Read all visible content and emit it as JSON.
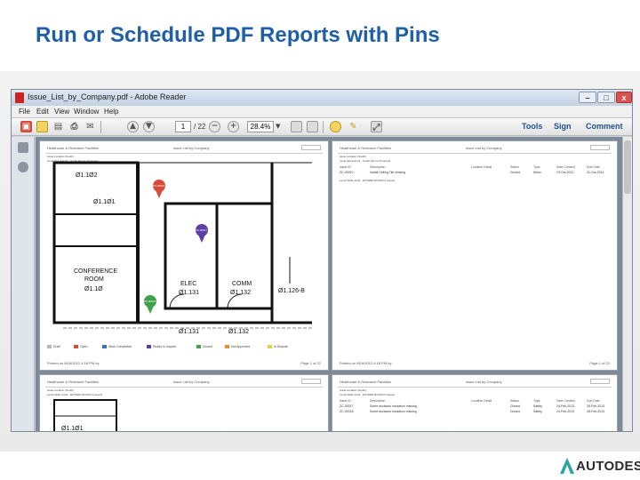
{
  "slide": {
    "title": "Run or Schedule PDF Reports with Pins",
    "brand": "AUTODESK."
  },
  "window": {
    "title": "Issue_List_by_Company.pdf - Adobe Reader",
    "min": "–",
    "max": "□",
    "close": "x"
  },
  "menu": [
    "File",
    "Edit",
    "View",
    "Window",
    "Help"
  ],
  "toolbar": {
    "page_current": "1",
    "page_total": "/ 22",
    "zoom": "28.4%",
    "tools": "Tools",
    "sign": "Sign",
    "comment": "Comment"
  },
  "report": {
    "project": "Healthcare & Research Facilities",
    "report_name": "Issue List by Company",
    "location_level": "Level 01/Level 01 - South Floors (3 Issues)",
    "location_sub": "Level 01/DL-1011 - ESTERN ROOM (3 issues)",
    "section": "Issue Location (South)",
    "footer_left": "Printed on 8/16/2012 4:18 PM by",
    "footer_right": "Page 1 of 22",
    "columns": [
      "Issue ID",
      "Description",
      "Location Detail",
      "Status",
      "Type",
      "Date Created",
      "Due Date"
    ],
    "rows_p2": [
      [
        "ZC-00010",
        "Install Ceiling Tile missing",
        "",
        "Closed",
        "Minor",
        "19-Oct-2012",
        "31-Oct-2012"
      ]
    ],
    "rows_p4": [
      [
        "ZC-00017",
        "Some ductwork insulation missing",
        "",
        "Closed",
        "Safety",
        "24-Feb-2013",
        "28-Feb-2013"
      ],
      [
        "ZC-00018",
        "Some ductwork insulation missing",
        "",
        "Closed",
        "Safety",
        "24-Feb-2013",
        "28-Feb-2013"
      ]
    ],
    "rooms": {
      "conference_label": "CONFERENCE",
      "conference_room": "ROOM",
      "conference_num": "Ø1.1Ø",
      "elec_label": "ELEC",
      "elec_num": "Ø1.131",
      "comm_label": "COMM",
      "comm_num": "Ø1.132",
      "r1": "Ø1.1Ø2",
      "r2": "Ø1.1Ø1",
      "r3": "Ø1.126-B",
      "r4": "Ø1.131",
      "r5": "Ø1.132",
      "p3_r1": "Ø1.1Ø1"
    },
    "pins": [
      {
        "id": "ZC-00010",
        "color": "#d64a3c"
      },
      {
        "id": "ZC-00017",
        "color": "#5b3fa6"
      },
      {
        "id": "ZC-00018",
        "color": "#3fa14a"
      }
    ],
    "legend": [
      {
        "label": "Draft",
        "color": "#b8b8b8"
      },
      {
        "label": "Open",
        "color": "#d64a3c"
      },
      {
        "label": "Work Completed",
        "color": "#3f6fbf"
      },
      {
        "label": "Ready to Inspect",
        "color": "#5b3fa6"
      },
      {
        "label": "Closed",
        "color": "#3fa14a"
      },
      {
        "label": "Not Approved",
        "color": "#e8902f"
      },
      {
        "label": "In Dispute",
        "color": "#e8d23a"
      }
    ]
  }
}
